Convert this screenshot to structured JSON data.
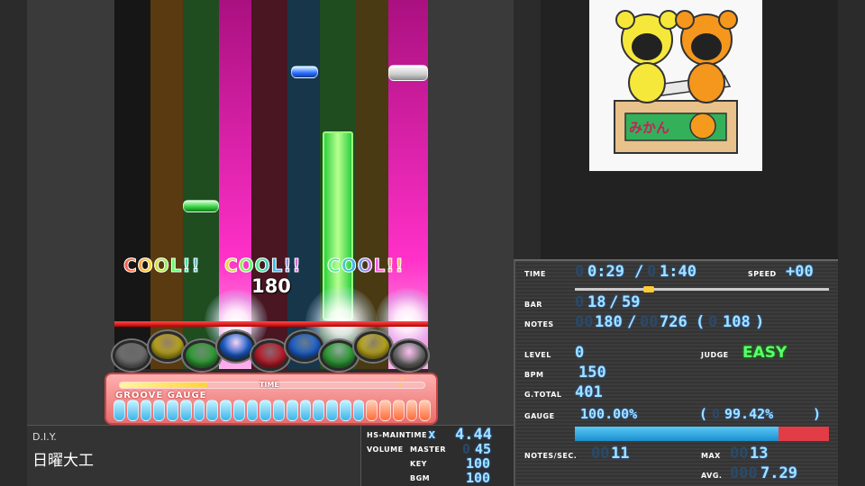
{
  "colors": {
    "lane_dark": "#1a1a1a",
    "lane_brown": "#5a3a10",
    "lane_green": "#1f4d20",
    "lane_magenta": "#ff20c0",
    "lane_maroon": "#4a1622",
    "lane_teal": "#17364a",
    "lane_olive": "#4a3a14",
    "lane_pink": "#ff30c8",
    "judge_line": "#e00000",
    "easy": "#5cff6a",
    "value_blue": "#9fe4ff",
    "gauge_blue": "#3bb4ea",
    "gauge_red": "#e23c46"
  },
  "icons": {
    "note_marker": "music-note-icon"
  },
  "playfield": {
    "judgements": [
      {
        "text": "COOL!!"
      },
      {
        "text": "COOL!!"
      },
      {
        "text": "COOL!!"
      }
    ],
    "combo": "180"
  },
  "buttons": [
    {
      "color": "#6e6e6e"
    },
    {
      "color": "#b7a41c"
    },
    {
      "color": "#2f9b36"
    },
    {
      "color": "#1d5fc8"
    },
    {
      "color": "#b61c2a"
    },
    {
      "color": "#1d5fc8"
    },
    {
      "color": "#2f9b36"
    },
    {
      "color": "#b7a41c"
    },
    {
      "color": "#6e6e6e"
    }
  ],
  "groove_gauge": {
    "label": "GROOVE GAUGE",
    "time_label": "TIME",
    "time_progress": 0.29,
    "fill_ratio": 0.79
  },
  "song": {
    "genre": "D.I.Y.",
    "title": "日曜大工"
  },
  "settings": {
    "hs_label": "HS-MAINTIME",
    "hs_x": "x",
    "hs_value": "4.44",
    "volume_label": "VOLUME",
    "master_label": "MASTER",
    "master_ghost": "0",
    "master_value": "45",
    "key_label": "KEY",
    "key_value": "100",
    "bgm_label": "BGM",
    "bgm_value": "100"
  },
  "bga": {
    "box_text": "みかん"
  },
  "stats": {
    "time_label": "TIME",
    "time_cur_ghost": "0",
    "time_cur": "0:29",
    "time_sep": "/",
    "time_total_ghost": "0",
    "time_total": "1:40",
    "speed_label": "SPEED",
    "speed_value": "+00",
    "song_progress": 0.29,
    "bar_label": "BAR",
    "bar_ghost": "0",
    "bar_cur": "18",
    "bar_sep": "/",
    "bar_total": "59",
    "notes_label": "NOTES",
    "notes_ghost": "00",
    "notes_cur": "180",
    "notes_sep": "/",
    "notes_total_ghost": "00",
    "notes_total": "726",
    "notes_paren_open": "(",
    "notes_sub_ghost": "0",
    "notes_sub": "108",
    "notes_paren_close": ")",
    "level_label": "LEVEL",
    "level_value": "0",
    "judge_label": "JUDGE",
    "judge_value": "EASY",
    "bpm_label": "BPM",
    "bpm_value": "150",
    "gtotal_label": "G.TOTAL",
    "gtotal_value": "401",
    "gauge_label": "GAUGE",
    "gauge_value": "100.00%",
    "gauge_paren_open": "(",
    "gauge_sub_ghost": "0",
    "gauge_sub": "99.42%",
    "gauge_paren_close": ")",
    "gauge_ratio": 0.8,
    "nps_label": "NOTES/SEC.",
    "nps_ghost": "00",
    "nps_value": "11",
    "max_label": "MAX",
    "max_ghost": "00",
    "max_value": "13",
    "avg_label": "AVG.",
    "avg_ghost": "000",
    "avg_value": "7.29"
  }
}
